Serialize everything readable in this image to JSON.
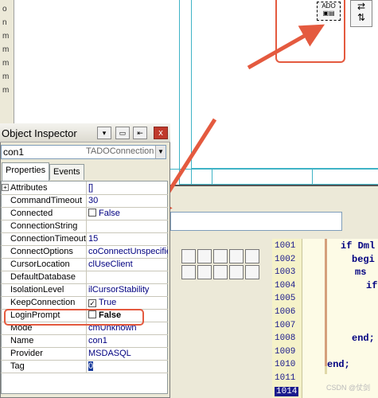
{
  "left_strip": {
    "items": [
      "o",
      "n",
      "m",
      "m",
      "m",
      "m",
      "m"
    ]
  },
  "inspector": {
    "title": "Object Inspector",
    "close_label": "x",
    "component_name": "con1",
    "component_type": "TADOConnection",
    "tabs": [
      {
        "label": "Properties"
      },
      {
        "label": "Events"
      }
    ],
    "properties": [
      {
        "name": "Attributes",
        "value": "[]",
        "expand": "+"
      },
      {
        "name": "CommandTimeout",
        "value": "30"
      },
      {
        "name": "Connected",
        "value": "False",
        "checkbox": true,
        "checked": false
      },
      {
        "name": "ConnectionString",
        "value": ""
      },
      {
        "name": "ConnectionTimeout",
        "value": "15"
      },
      {
        "name": "ConnectOptions",
        "value": "coConnectUnspecified"
      },
      {
        "name": "CursorLocation",
        "value": "clUseClient"
      },
      {
        "name": "DefaultDatabase",
        "value": ""
      },
      {
        "name": "IsolationLevel",
        "value": "ilCursorStability"
      },
      {
        "name": "KeepConnection",
        "value": "True",
        "checkbox": true,
        "checked": true
      },
      {
        "name": "LoginPrompt",
        "value": "False",
        "checkbox": true,
        "checked": false
      },
      {
        "name": "Mode",
        "value": "cmUnknown"
      },
      {
        "name": "Name",
        "value": "con1"
      },
      {
        "name": "Provider",
        "value": "MSDASQL"
      },
      {
        "name": "Tag",
        "value": "0"
      }
    ]
  },
  "editor": {
    "line_numbers": [
      "1001",
      "1002",
      "1003",
      "1004",
      "1005",
      "1006",
      "1007",
      "1008",
      "1009",
      "1010",
      "1011",
      "1014"
    ],
    "active_line": "1014",
    "code": [
      "if Dml",
      "begi",
      "ms",
      "if",
      "",
      "",
      "",
      "end;",
      "",
      "end;"
    ]
  },
  "designer": {
    "component_caption": "ADO"
  },
  "watermark": "CSDN @仗剑",
  "colors": {
    "annotation_red": "#e45a3f",
    "form_border": "#3fb3c6",
    "value_blue": "#000080"
  }
}
